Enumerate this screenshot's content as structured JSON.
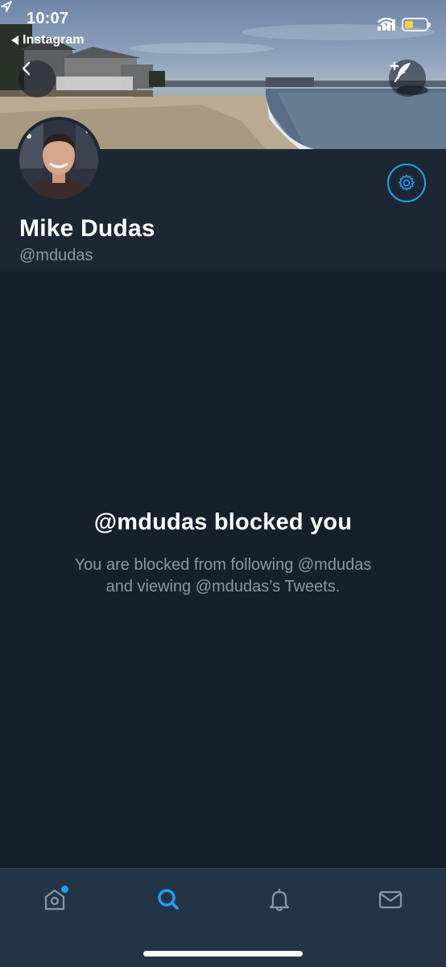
{
  "status_bar": {
    "time": "10:07",
    "back_app": "Instagram",
    "battery_color": "#f5d33a"
  },
  "banner": {
    "back_icon": "chevron-left-icon",
    "compose_icon": "compose-tweet-icon"
  },
  "profile": {
    "name": "Mike Dudas",
    "handle": "@mdudas",
    "settings_icon": "gear-icon"
  },
  "blocked": {
    "title": "@mdudas blocked you",
    "line1": "You are blocked from following @mdudas",
    "line2": "and viewing @mdudas’s Tweets."
  },
  "tabs": [
    {
      "icon": "home-icon",
      "active": false,
      "has_badge": true
    },
    {
      "icon": "search-icon",
      "active": true
    },
    {
      "icon": "notifications-bell-icon",
      "active": false
    },
    {
      "icon": "messages-envelope-icon",
      "active": false
    }
  ],
  "colors": {
    "accent": "#1da1f2",
    "background": "#15202b",
    "header_bg": "#1c2733",
    "tabbar_bg": "#243447",
    "secondary_text": "#8899a6"
  }
}
